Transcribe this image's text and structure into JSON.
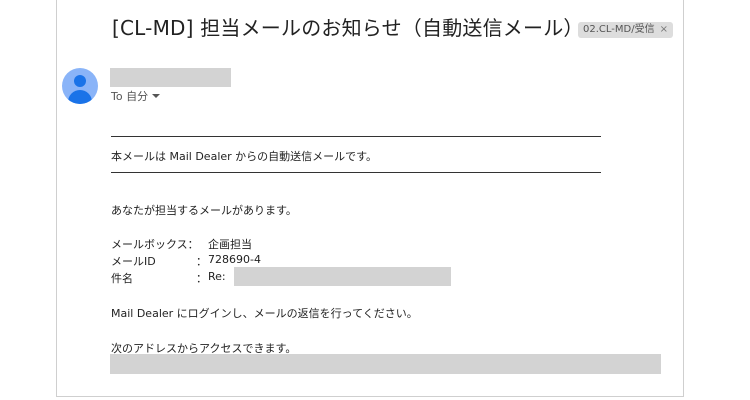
{
  "header": {
    "subject": "[CL-MD] 担当メールのお知らせ（自動送信メール）",
    "label": "02.CL-MD/受信",
    "label_remove": "×"
  },
  "sender": {
    "to_line": "To 自分"
  },
  "message": {
    "notice": "本メールは Mail Dealer からの自動送信メールです。",
    "assigned": "あなたが担当するメールがあります。",
    "mailbox_label": "メールボックス：",
    "mailbox_value": "企画担当",
    "mailid_label": "メールID",
    "mailid_colon": "：",
    "mailid_value": "728690-4",
    "subject_label": "件名",
    "subject_colon": "：",
    "subject_value": "Re:",
    "login_instruction": "Mail Dealer にログインし、メールの返信を行ってください。",
    "access_text": "次のアドレスからアクセスできます。"
  }
}
